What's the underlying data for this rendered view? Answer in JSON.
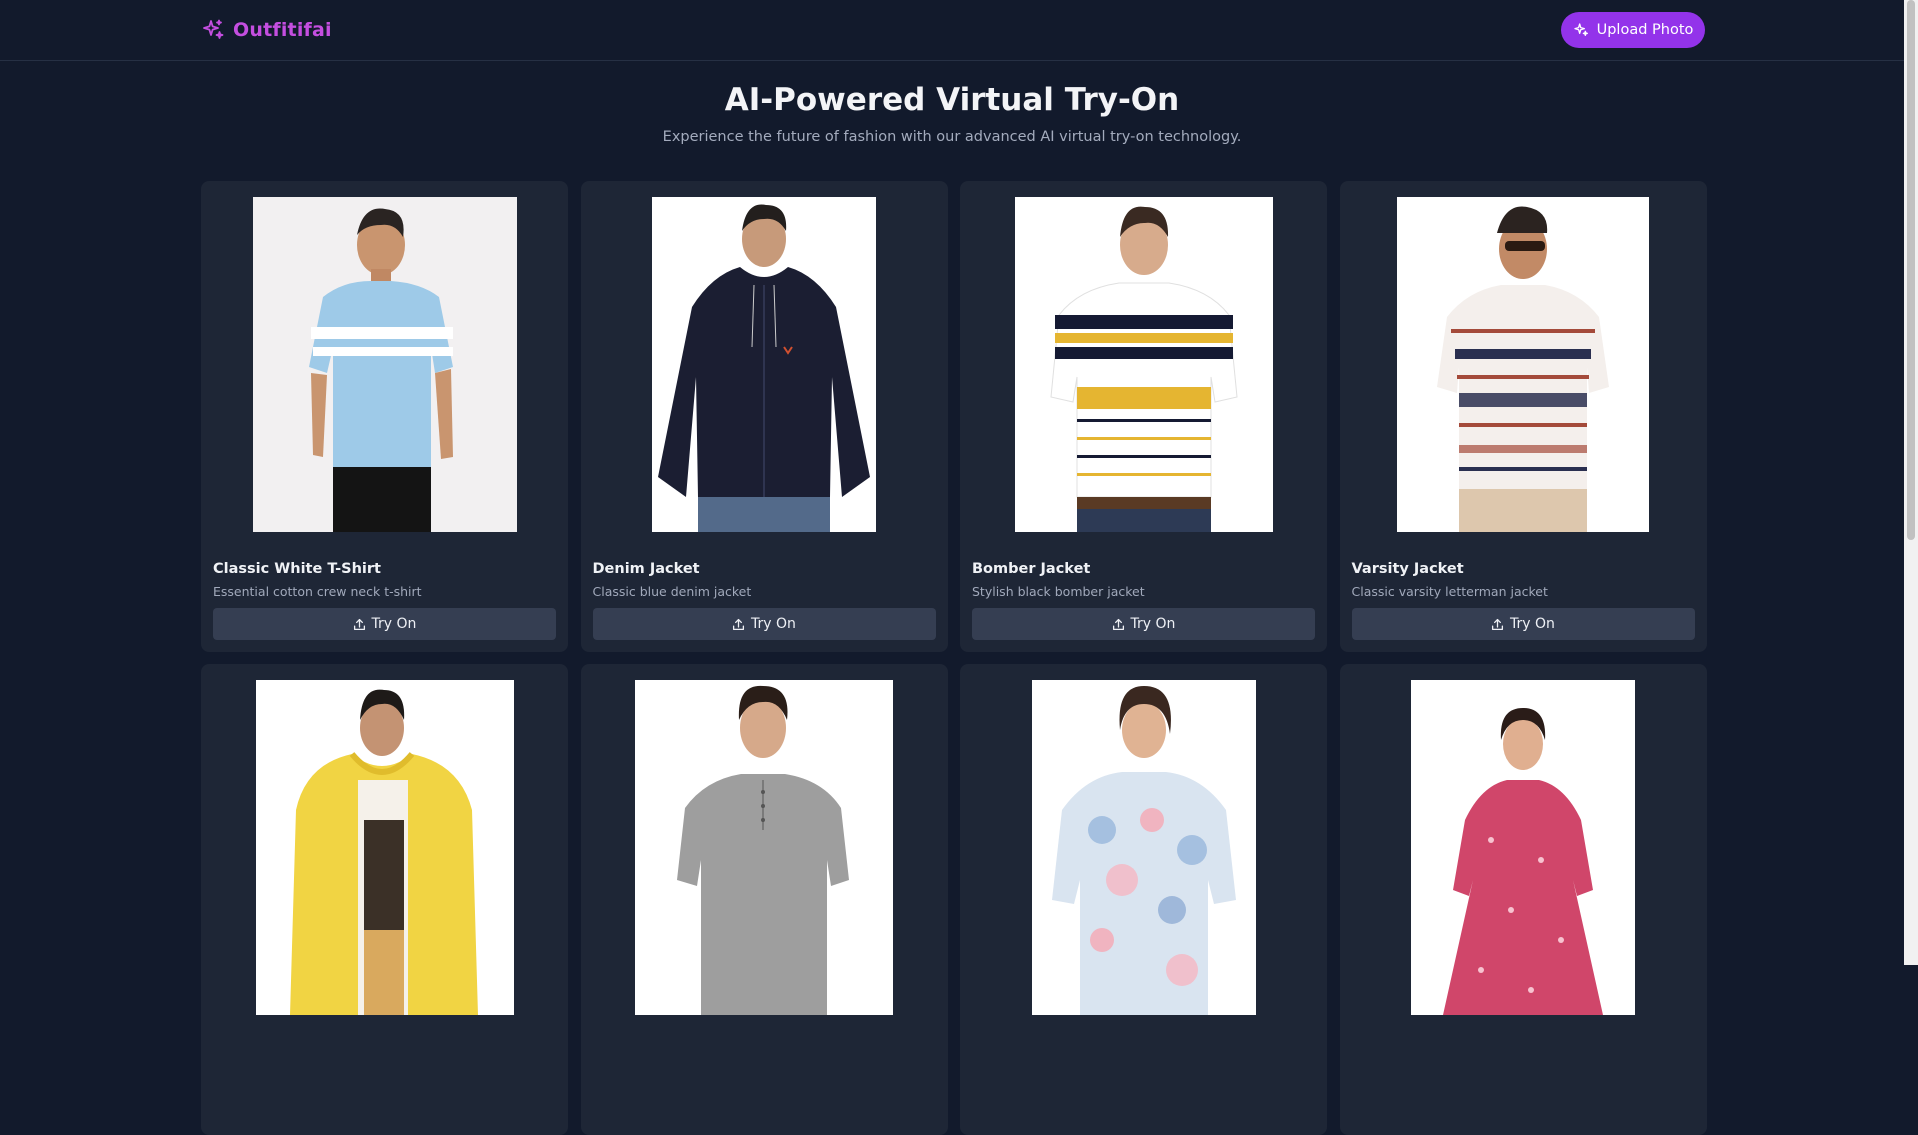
{
  "app": {
    "name": "Outfitifai"
  },
  "header": {
    "upload_label": "Upload Photo"
  },
  "hero": {
    "title": "AI-Powered Virtual Try-On",
    "subtitle": "Experience the future of fashion with our advanced AI virtual try-on technology."
  },
  "colors": {
    "accent": "#9333ea",
    "logo": "#c44ee0",
    "background": "#121a2c",
    "card": "#1e2636",
    "button": "#353e52"
  },
  "products": [
    {
      "name": "Classic White T-Shirt",
      "description": "Essential cotton crew neck t-shirt",
      "button": "Try On",
      "garment": "light-blue striped t-shirt"
    },
    {
      "name": "Denim Jacket",
      "description": "Classic blue denim jacket",
      "button": "Try On",
      "garment": "navy zip hoodie"
    },
    {
      "name": "Bomber Jacket",
      "description": "Stylish black bomber jacket",
      "button": "Try On",
      "garment": "striped polo shirt"
    },
    {
      "name": "Varsity Jacket",
      "description": "Classic varsity letterman jacket",
      "button": "Try On",
      "garment": "patterned t-shirt"
    },
    {
      "name": "",
      "description": "",
      "button": "",
      "garment": "yellow zip hoodie"
    },
    {
      "name": "",
      "description": "",
      "button": "",
      "garment": "grey henley t-shirt"
    },
    {
      "name": "",
      "description": "",
      "button": "",
      "garment": "floral top"
    },
    {
      "name": "",
      "description": "",
      "button": "",
      "garment": "pink dress"
    }
  ]
}
